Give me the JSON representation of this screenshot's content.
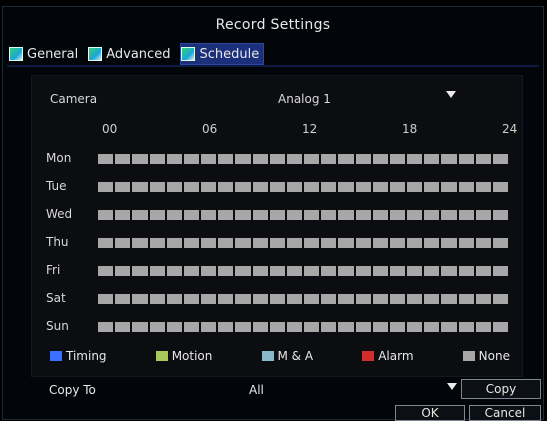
{
  "window": {
    "title": "Record Settings"
  },
  "tabs": [
    {
      "label": "General",
      "active": false
    },
    {
      "label": "Advanced",
      "active": false
    },
    {
      "label": "Schedule",
      "active": true
    }
  ],
  "camera": {
    "label": "Camera",
    "value": "Analog 1"
  },
  "timeline": {
    "hours": [
      "00",
      "06",
      "12",
      "18",
      "24"
    ],
    "days": [
      {
        "label": "Mon"
      },
      {
        "label": "Tue"
      },
      {
        "label": "Wed"
      },
      {
        "label": "Thu"
      },
      {
        "label": "Fri"
      },
      {
        "label": "Sat"
      },
      {
        "label": "Sun"
      }
    ]
  },
  "legend": [
    {
      "label": "Timing",
      "color": "#3b6fff"
    },
    {
      "label": "Motion",
      "color": "#a8c85a"
    },
    {
      "label": "M & A",
      "color": "#87b8c8"
    },
    {
      "label": "Alarm",
      "color": "#d32d2d"
    },
    {
      "label": "None",
      "color": "#a7a7a7"
    }
  ],
  "copy_to": {
    "label": "Copy To",
    "value": "All",
    "button": "Copy"
  },
  "actions": {
    "ok": "OK",
    "cancel": "Cancel"
  },
  "colors": {
    "tab_active_bg": "#1b2f7a",
    "schedule_bar_none": "#a7a7a7"
  }
}
